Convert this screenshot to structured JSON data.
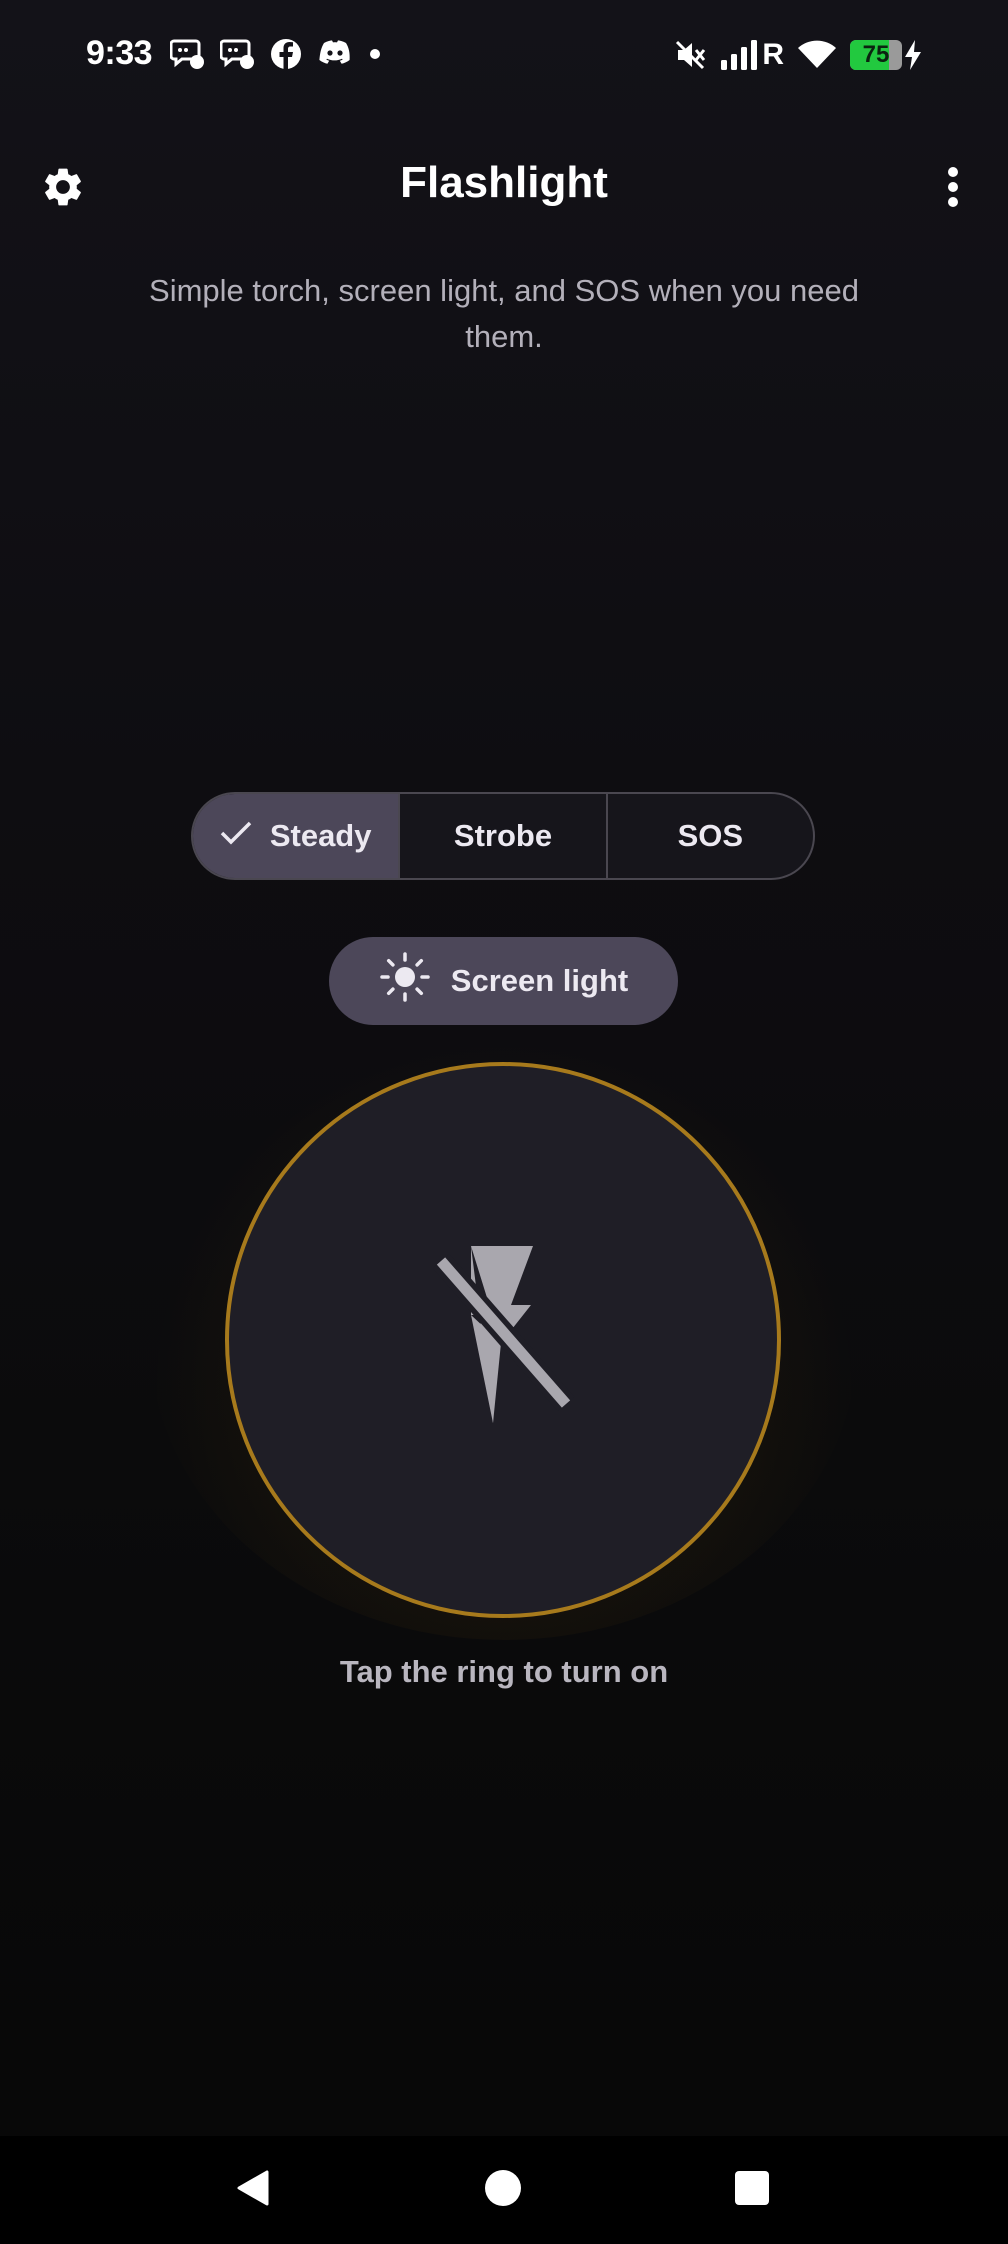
{
  "status_bar": {
    "time": "9:33",
    "notification_icons": [
      "chat-bubble-icon",
      "chat-bubble-icon",
      "facebook-icon",
      "discord-icon",
      "dot-icon"
    ],
    "network_label": "R",
    "battery_percent": "75",
    "battery_level": 0.75,
    "battery_charging": true,
    "icons": [
      "mute-icon",
      "signal-icon",
      "wifi-icon",
      "battery-icon",
      "charging-icon"
    ]
  },
  "app_bar": {
    "title": "Flashlight",
    "left_icon": "gear-icon",
    "right_icon": "more-vert-icon"
  },
  "subtitle": "Simple torch, screen light, and SOS when you need them.",
  "modes": {
    "selected": "Steady",
    "items": [
      {
        "label": "Steady"
      },
      {
        "label": "Strobe"
      },
      {
        "label": "SOS"
      }
    ]
  },
  "screen_light": {
    "label": "Screen light",
    "icon": "sun-icon"
  },
  "power_ring": {
    "icon": "flash-off-icon",
    "ring_color": "#a77a1c",
    "hint": "Tap the ring to turn on"
  },
  "nav_bar": {
    "icons": [
      "back-icon",
      "home-icon",
      "recents-icon"
    ]
  },
  "colors": {
    "accent_gold": "#a77a1c",
    "segment_selected": "#4c4759",
    "battery_green": "#22c93f"
  }
}
